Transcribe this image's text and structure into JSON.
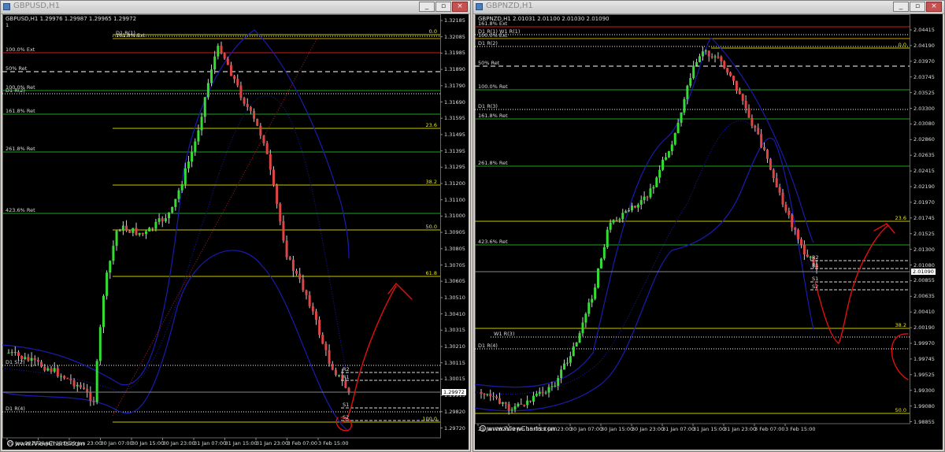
{
  "windows": [
    {
      "key": "left",
      "title": "GBPUSD,H1",
      "symbol_info": "GBPUSD,H1  1.29976 1.29987 1.29965 1.29972",
      "indicator_value": "1",
      "current_price": "1.29972",
      "watermark": "www.iViewCharts.com",
      "window_buttons": [
        "_",
        "▫",
        "×"
      ],
      "price_labels": [
        "1.32185",
        "1.32085",
        "1.31985",
        "1.31890",
        "1.31790",
        "1.31690",
        "1.31595",
        "1.31495",
        "1.31395",
        "1.31295",
        "1.31200",
        "1.31100",
        "1.31000",
        "1.30905",
        "1.30805",
        "1.30705",
        "1.30605",
        "1.30510",
        "1.30410",
        "1.30315",
        "1.30210",
        "1.30115",
        "1.30015",
        "1.29915",
        "1.29820",
        "1.29720"
      ],
      "time_labels": [
        "29 Jan 2020",
        "29 Jan 15:00",
        "29 Jan 23:00",
        "30 Jan 07:00",
        "30 Jan 15:00",
        "30 Jan 23:00",
        "31 Jan 07:00",
        "31 Jan 15:00",
        "31 Jan 23:00",
        "3 Feb 07:00",
        "3 Feb 15:00"
      ],
      "levels": [
        {
          "text": "D1 R(1)",
          "color": "#ffffff",
          "dash": "1,2"
        },
        {
          "text": "161.8% Ext",
          "color": "#c8a000",
          "dash": ""
        },
        {
          "text": "100.0% Ext",
          "color": "#d01818",
          "dash": ""
        },
        {
          "text": "50% Ret",
          "color": "#ffffff",
          "dash": "6,4"
        },
        {
          "text": "100.0% Ret",
          "color": "#1fa01f",
          "dash": ""
        },
        {
          "text": "D1 R(2)",
          "color": "#ffffff",
          "dash": "1,2"
        },
        {
          "text": "161.8% Ret",
          "color": "#1fa01f",
          "dash": ""
        },
        {
          "text": "261.8% Ret",
          "color": "#1fa01f",
          "dash": ""
        },
        {
          "text": "423.6% Ret",
          "color": "#1fa01f",
          "dash": ""
        },
        {
          "text": "D1 S(2)",
          "color": "#ffffff",
          "dash": "1,2"
        },
        {
          "text": "D1 R(4)",
          "color": "#ffffff",
          "dash": "1,2"
        }
      ],
      "fib_levels": [
        "0.0",
        "23.6",
        "38.2",
        "50.0",
        "61.8",
        "100.0"
      ],
      "pivots": [
        "R2",
        "R1",
        "S1",
        "S2"
      ]
    },
    {
      "key": "right",
      "title": "GBPNZD,H1",
      "symbol_info": "GBPNZD,H1  2.01031 2.01100 2.01030 2.01090",
      "current_price": "2.01090",
      "watermark": "www.iViewCharts.com",
      "window_buttons": [
        "_",
        "▫",
        "×"
      ],
      "price_labels": [
        "2.04415",
        "2.04190",
        "2.03970",
        "2.03745",
        "2.03525",
        "2.03300",
        "2.03080",
        "2.02860",
        "2.02635",
        "2.02415",
        "2.02190",
        "2.01970",
        "2.01745",
        "2.01525",
        "2.01300",
        "2.01080",
        "2.00855",
        "2.00635",
        "2.00410",
        "2.00190",
        "1.99970",
        "1.99745",
        "1.99525",
        "1.99300",
        "1.99080",
        "1.98855"
      ],
      "time_labels": [
        "29 Jan 2020",
        "29 Jan 15:00",
        "29 Jan 23:00",
        "30 Jan 07:00",
        "30 Jan 15:00",
        "30 Jan 23:00",
        "31 Jan 07:00",
        "31 Jan 15:00",
        "31 Jan 23:00",
        "3 Feb 07:00",
        "3 Feb 15:00"
      ],
      "levels": [
        {
          "text": "161.8% Ext",
          "color": "#d01818",
          "dash": ""
        },
        {
          "text": "D1 R(1)  W1 R(1)",
          "color": "#ffffff",
          "dash": "1,2"
        },
        {
          "text": "100.0% Ext",
          "color": "#c8a000",
          "dash": ""
        },
        {
          "text": "D1 R(2)",
          "color": "#ffffff",
          "dash": "1,2"
        },
        {
          "text": "50% Ret",
          "color": "#ffffff",
          "dash": "6,4"
        },
        {
          "text": "100.0% Ret",
          "color": "#1fa01f",
          "dash": ""
        },
        {
          "text": "D1 R(3)",
          "color": "#ffffff",
          "dash": "1,2"
        },
        {
          "text": "161.8% Ret",
          "color": "#1fa01f",
          "dash": ""
        },
        {
          "text": "261.8% Ret",
          "color": "#1fa01f",
          "dash": ""
        },
        {
          "text": "423.6% Ret",
          "color": "#1fa01f",
          "dash": ""
        },
        {
          "text": "W1 R(3)",
          "color": "#ffffff",
          "dash": "1,2"
        },
        {
          "text": "D1 R(4)",
          "color": "#ffffff",
          "dash": "1,2"
        }
      ],
      "fib_levels": [
        "0.0",
        "23.6",
        "38.2",
        "50.0"
      ],
      "pivots": [
        "R2",
        "R1",
        "S1",
        "S2"
      ]
    }
  ],
  "colors": {
    "bull": "#33dd33",
    "bear": "#e04444",
    "bands": "#1b1bb0",
    "annotation": "#e01010",
    "fib": "#c8c800"
  }
}
